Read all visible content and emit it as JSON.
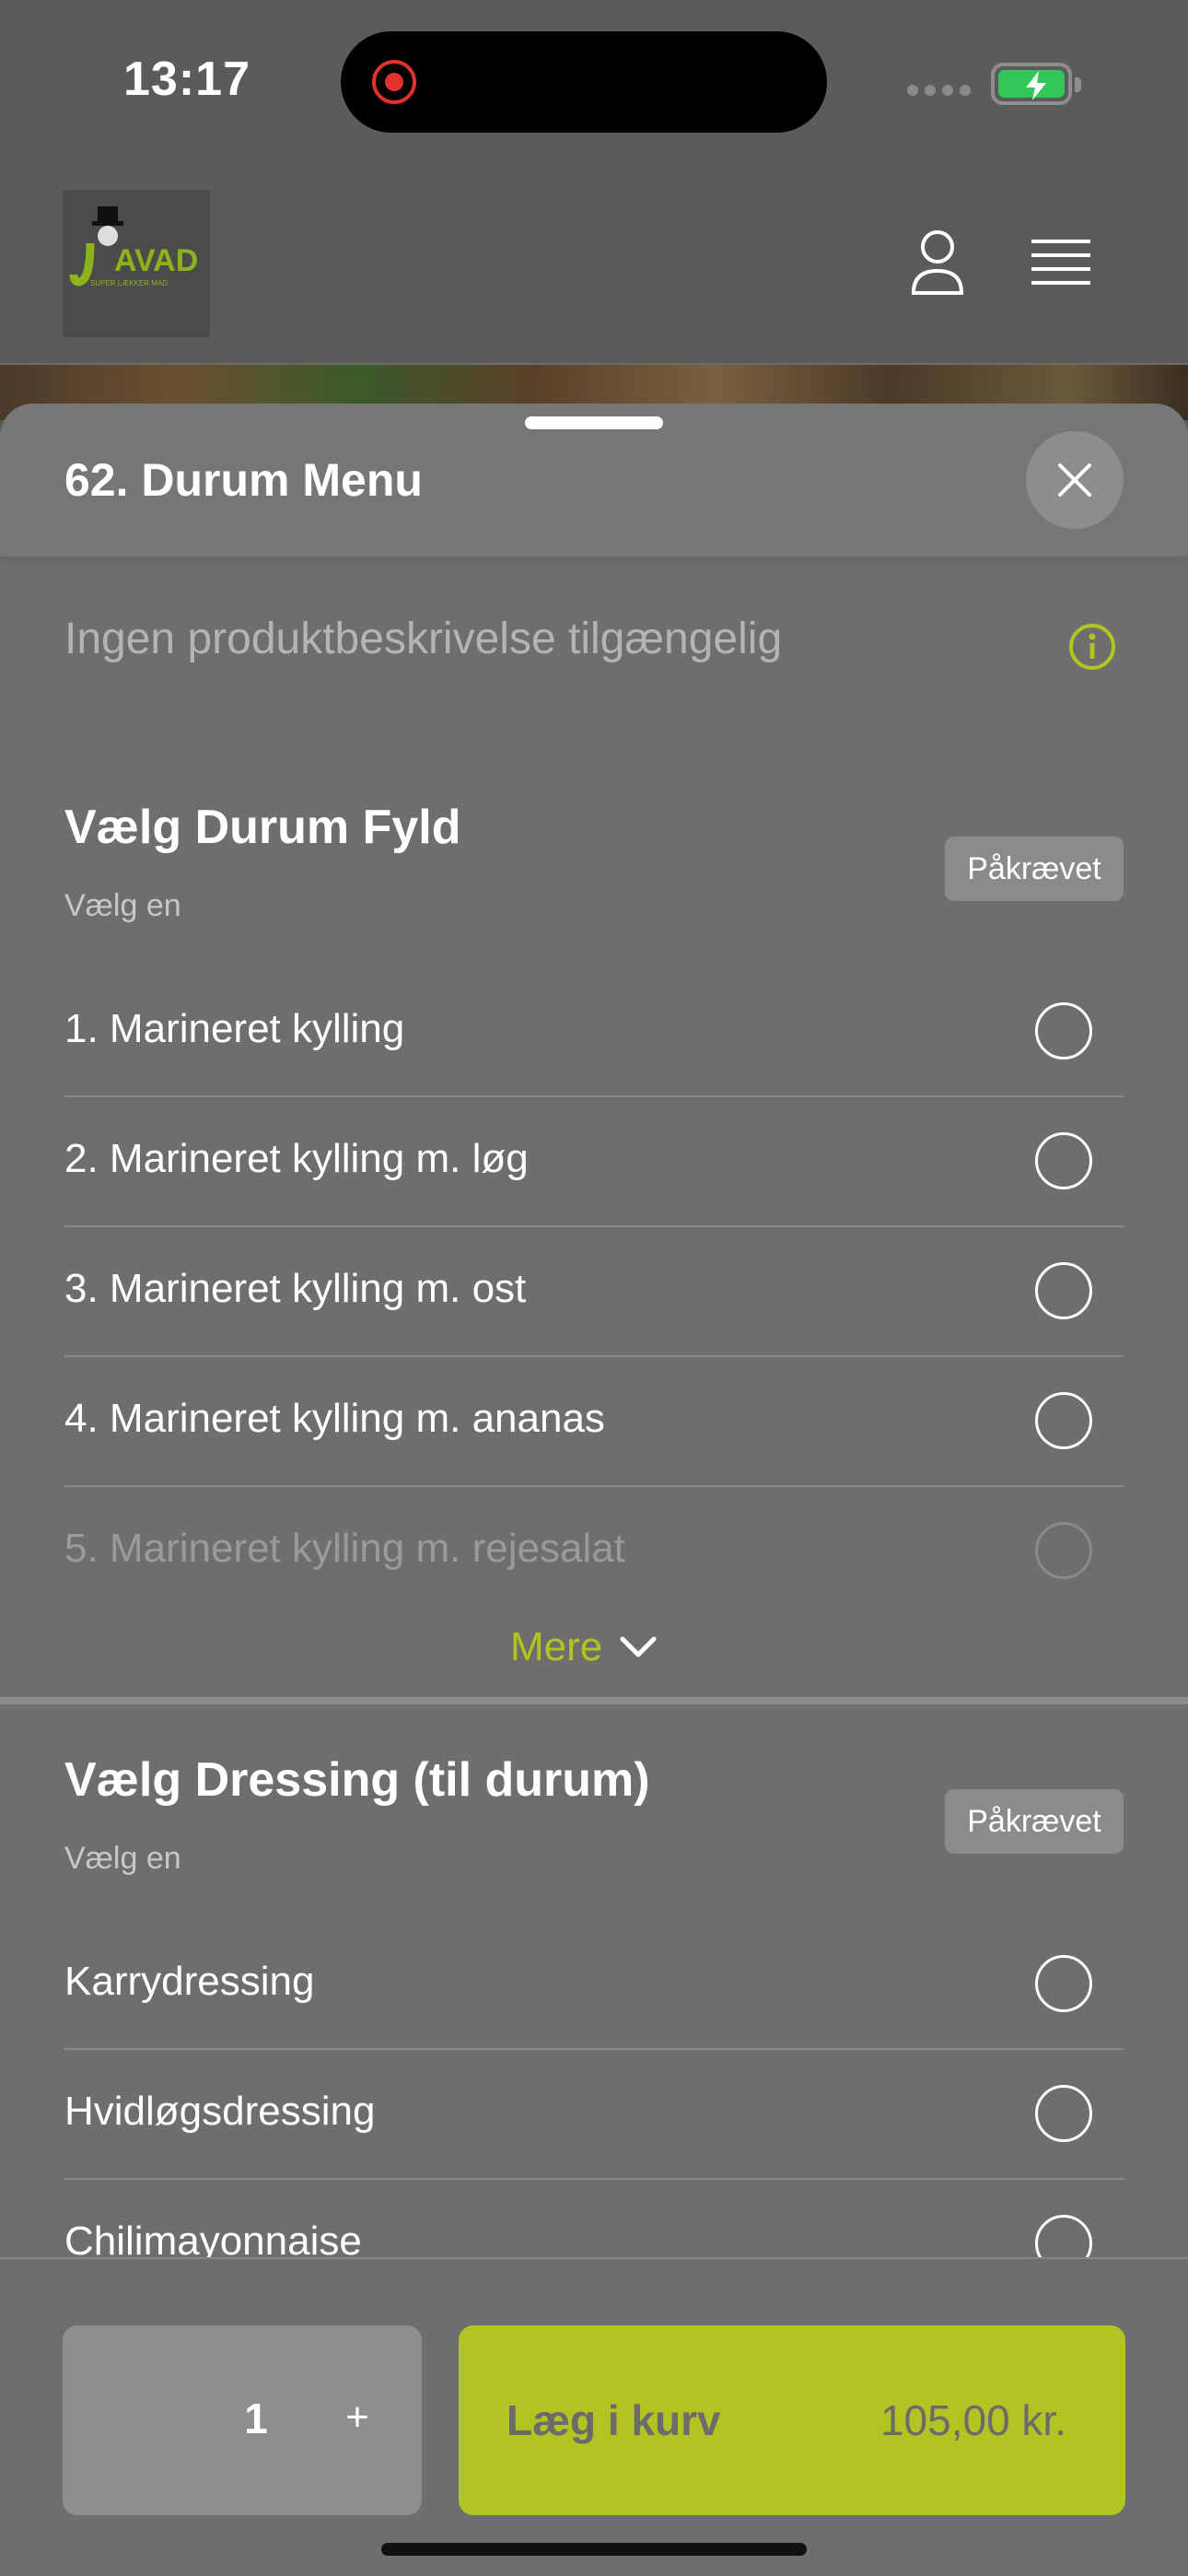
{
  "status_bar": {
    "time": "13:17"
  },
  "header": {
    "logo_text": "JAVAD",
    "logo_tagline": "SUPER LÆKKER MAD"
  },
  "sheet": {
    "title": "62. Durum Menu",
    "description": "Ingen produktbeskrivelse tilgængelig"
  },
  "groups": [
    {
      "title": "Vælg Durum Fyld",
      "subtitle": "Vælg en",
      "badge": "Påkrævet",
      "options": [
        "1. Marineret kylling",
        "2. Marineret kylling m. løg",
        "3. Marineret kylling m. ost",
        "4. Marineret kylling m. ananas",
        "5. Marineret kylling m. rejesalat"
      ],
      "more_label": "Mere"
    },
    {
      "title": "Vælg Dressing (til durum)",
      "subtitle": "Vælg en",
      "badge": "Påkrævet",
      "options": [
        "Karrydressing",
        "Hvidløgsdressing",
        "Chilimayonnaise"
      ]
    }
  ],
  "footer": {
    "quantity": "1",
    "plus": "+",
    "add_label": "Læg i kurv",
    "price": "105,00 kr."
  },
  "colors": {
    "accent": "#b1c421",
    "sheet_bg": "#6e6e6e"
  }
}
